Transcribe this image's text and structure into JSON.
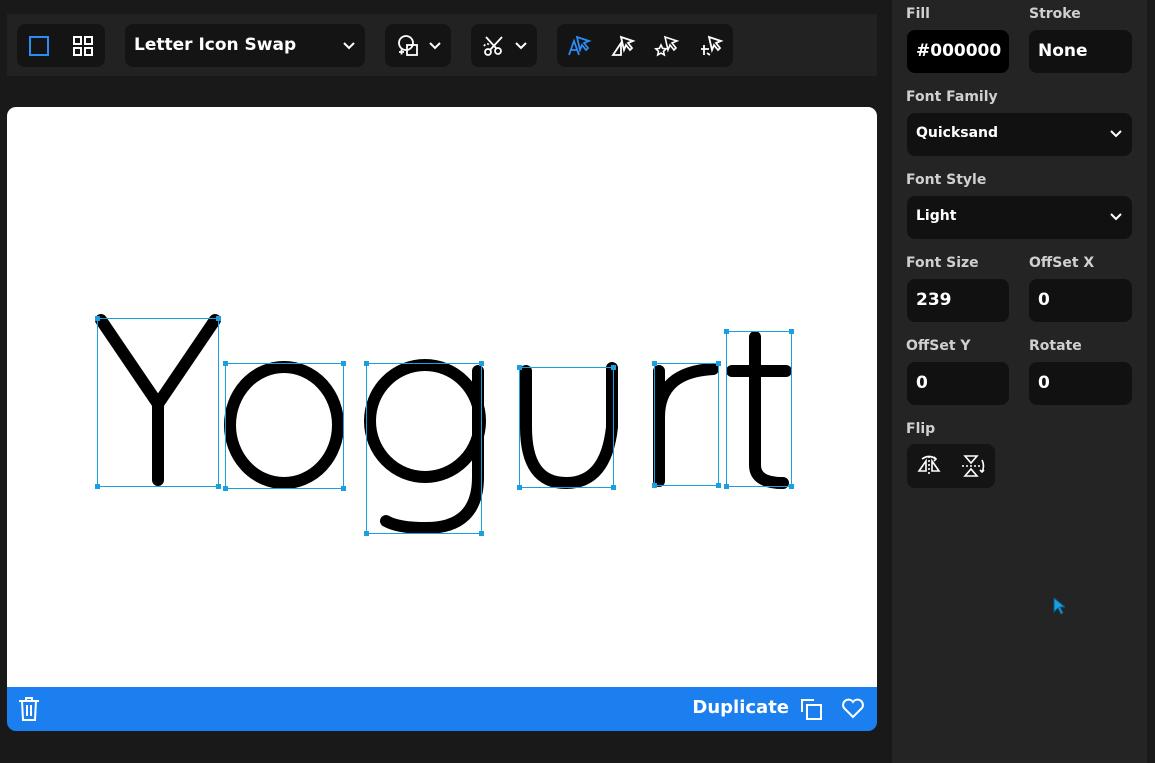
{
  "toolbar": {
    "preset": "Letter Icon Swap",
    "icons": {
      "single_view": "square-icon",
      "grid_view": "grid-icon",
      "shapes": "shapes-icon",
      "cut": "scissors-icon",
      "tools": [
        "select-letter-icon",
        "select-shape-icon",
        "select-star-icon",
        "select-scatter-icon"
      ]
    }
  },
  "canvas": {
    "letters": [
      "Y",
      "o",
      "g",
      "u",
      "r",
      "t"
    ],
    "text_color": "#000000",
    "selection_color": "#1aa0e0"
  },
  "bottom_bar": {
    "duplicate_label": "Duplicate",
    "color": "#1b7ff0"
  },
  "panel": {
    "fill_label": "Fill",
    "fill_value": "#000000",
    "stroke_label": "Stroke",
    "stroke_value": "None",
    "font_family_label": "Font Family",
    "font_family_value": "Quicksand",
    "font_style_label": "Font Style",
    "font_style_value": "Light",
    "font_size_label": "Font Size",
    "font_size_value": "239",
    "offset_x_label": "OffSet X",
    "offset_x_value": "0",
    "offset_y_label": "OffSet Y",
    "offset_y_value": "0",
    "rotate_label": "Rotate",
    "rotate_value": "0",
    "flip_label": "Flip"
  }
}
